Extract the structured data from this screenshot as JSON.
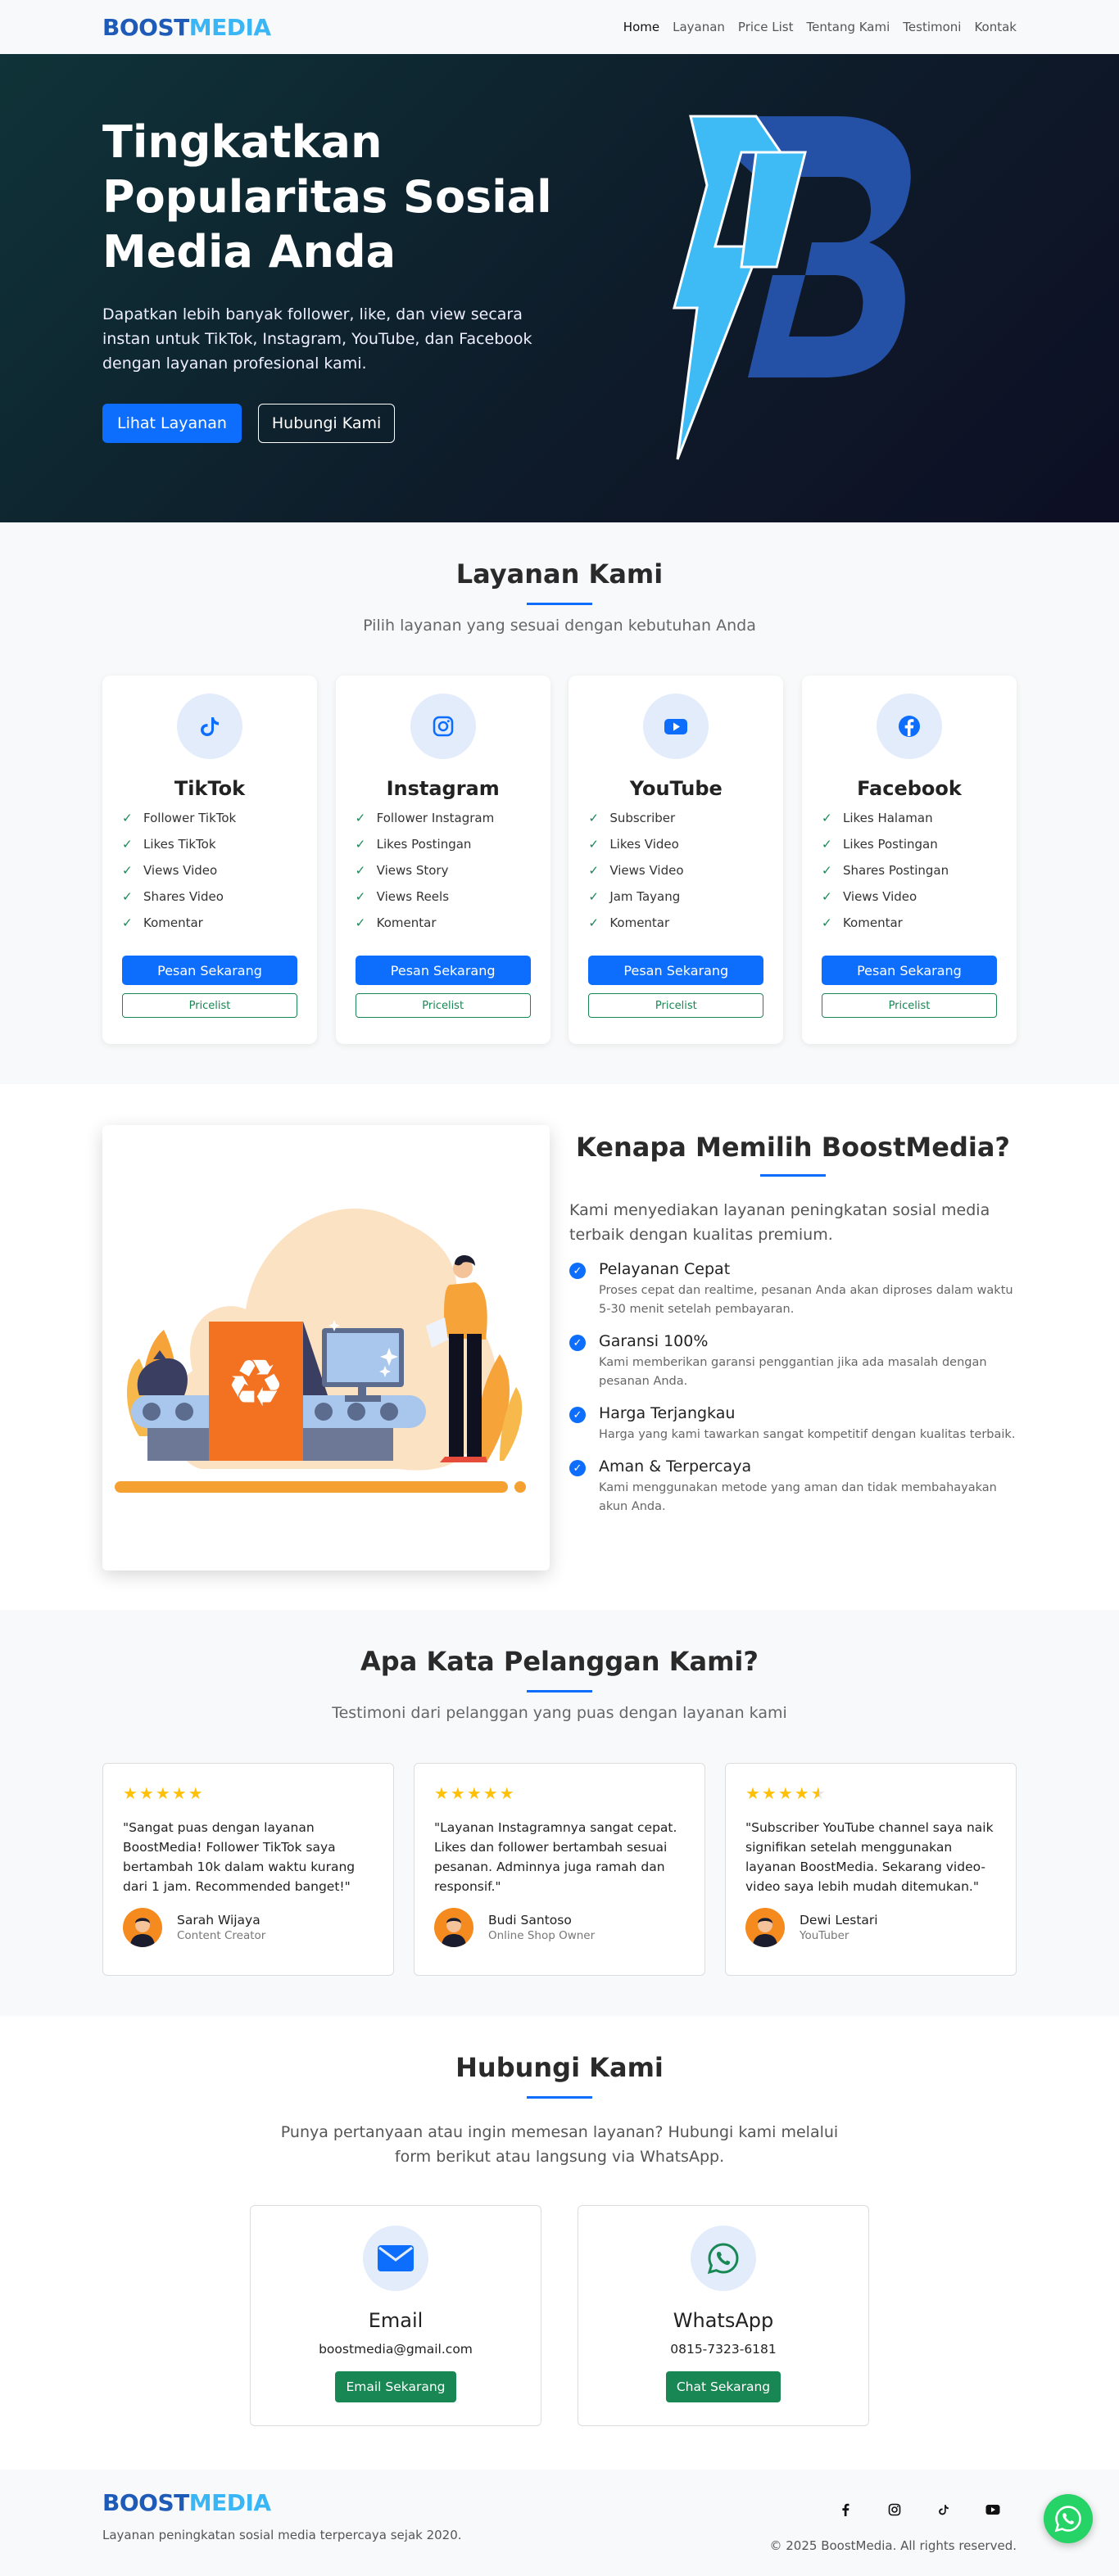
{
  "brand": {
    "part1": "BOOST",
    "part2": "MEDIA"
  },
  "nav": {
    "items": [
      "Home",
      "Layanan",
      "Price List",
      "Tentang Kami",
      "Testimoni",
      "Kontak"
    ]
  },
  "hero": {
    "title": "Tingkatkan Popularitas Sosial Media Anda",
    "subtitle": "Dapatkan lebih banyak follower, like, dan view secara instan untuk TikTok, Instagram, YouTube, dan Facebook dengan layanan profesional kami.",
    "primary_btn": "Lihat Layanan",
    "secondary_btn": "Hubungi Kami"
  },
  "services": {
    "title": "Layanan Kami",
    "subtitle": "Pilih layanan yang sesuai dengan kebutuhan Anda",
    "order_label": "Pesan Sekarang",
    "pricelist_label": "Pricelist",
    "cards": [
      {
        "name": "TikTok",
        "icon": "tiktok-icon",
        "features": [
          "Follower TikTok",
          "Likes TikTok",
          "Views Video",
          "Shares Video",
          "Komentar"
        ]
      },
      {
        "name": "Instagram",
        "icon": "instagram-icon",
        "features": [
          "Follower Instagram",
          "Likes Postingan",
          "Views Story",
          "Views Reels",
          "Komentar"
        ]
      },
      {
        "name": "YouTube",
        "icon": "youtube-icon",
        "features": [
          "Subscriber",
          "Likes Video",
          "Views Video",
          "Jam Tayang",
          "Komentar"
        ]
      },
      {
        "name": "Facebook",
        "icon": "facebook-icon",
        "features": [
          "Likes Halaman",
          "Likes Postingan",
          "Shares Postingan",
          "Views Video",
          "Komentar"
        ]
      }
    ]
  },
  "why": {
    "title": "Kenapa Memilih BoostMedia?",
    "desc": "Kami menyediakan layanan peningkatan sosial media terbaik dengan kualitas premium.",
    "reasons": [
      {
        "title": "Pelayanan Cepat",
        "text": "Proses cepat dan realtime, pesanan Anda akan diproses dalam waktu 5-30 menit setelah pembayaran."
      },
      {
        "title": "Garansi 100%",
        "text": "Kami memberikan garansi penggantian jika ada masalah dengan pesanan Anda."
      },
      {
        "title": "Harga Terjangkau",
        "text": "Harga yang kami tawarkan sangat kompetitif dengan kualitas terbaik."
      },
      {
        "title": "Aman & Terpercaya",
        "text": "Kami menggunakan metode yang aman dan tidak membahayakan akun Anda."
      }
    ]
  },
  "testimonials": {
    "title": "Apa Kata Pelanggan Kami?",
    "subtitle": "Testimoni dari pelanggan yang puas dengan layanan kami",
    "items": [
      {
        "rating": 5,
        "quote": "\"Sangat puas dengan layanan BoostMedia! Follower TikTok saya bertambah 10k dalam waktu kurang dari 1 jam. Recommended banget!\"",
        "name": "Sarah Wijaya",
        "role": "Content Creator"
      },
      {
        "rating": 5,
        "quote": "\"Layanan Instagramnya sangat cepat. Likes dan follower bertambah sesuai pesanan. Adminnya juga ramah dan responsif.\"",
        "name": "Budi Santoso",
        "role": "Online Shop Owner"
      },
      {
        "rating": 4.5,
        "quote": "\"Subscriber YouTube channel saya naik signifikan setelah menggunakan layanan BoostMedia. Sekarang video-video saya lebih mudah ditemukan.\"",
        "name": "Dewi Lestari",
        "role": "YouTuber"
      }
    ]
  },
  "contact": {
    "title": "Hubungi Kami",
    "subtitle": "Punya pertanyaan atau ingin memesan layanan? Hubungi kami melalui form berikut atau langsung via WhatsApp.",
    "email": {
      "title": "Email",
      "value": "boostmedia@gmail.com",
      "button": "Email Sekarang"
    },
    "whatsapp": {
      "title": "WhatsApp",
      "value": "0815-7323-6181",
      "button": "Chat Sekarang"
    }
  },
  "footer": {
    "tagline": "Layanan peningkatan sosial media terpercaya sejak 2020.",
    "copyright": "© 2025 BoostMedia. All rights reserved.",
    "socials": [
      "facebook-icon",
      "instagram-icon",
      "tiktok-icon",
      "youtube-icon"
    ]
  },
  "colors": {
    "primary": "#0d6efd",
    "success": "#198754",
    "brand_dark": "#1e5bb8",
    "brand_light": "#38b6f5",
    "star": "#ffc107",
    "whatsapp": "#25d366"
  }
}
